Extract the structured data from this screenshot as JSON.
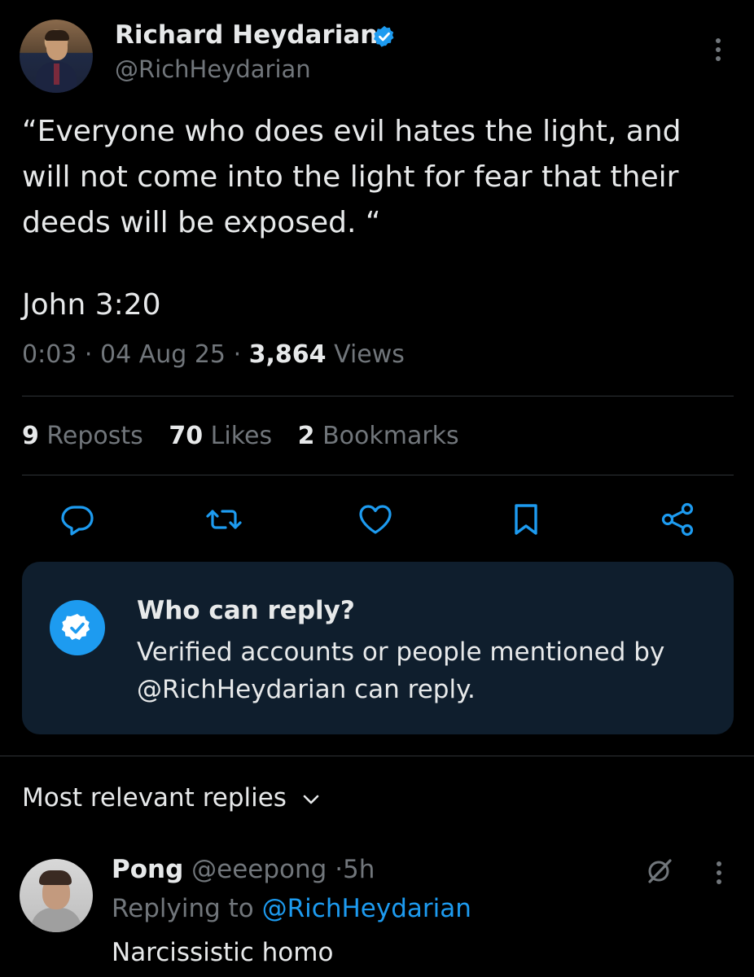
{
  "tweet": {
    "author_name": "Richard Heydarian",
    "author_handle": "@RichHeydarian",
    "text": "“Everyone who does evil hates the light, and will not come into the light for fear that their deeds will be exposed. “",
    "reference": "John 3:20",
    "time": "0:03",
    "date": "04 Aug 25",
    "views_count": "3,864",
    "views_label": "Views",
    "separator": "·"
  },
  "stats": {
    "reposts_count": "9",
    "reposts_label": "Reposts",
    "likes_count": "70",
    "likes_label": "Likes",
    "bookmarks_count": "2",
    "bookmarks_label": "Bookmarks"
  },
  "actions": {
    "icons": [
      "reply-icon",
      "repost-icon",
      "like-icon",
      "bookmark-icon",
      "share-icon"
    ]
  },
  "reply_settings": {
    "title": "Who can reply?",
    "description": "Verified accounts or people mentioned by @RichHeydarian can reply."
  },
  "replies": {
    "heading": "Most relevant replies",
    "items": [
      {
        "name": "Pong",
        "handle": "@eeepong",
        "separator": "·",
        "time": "5h",
        "replying_prefix": "Replying to",
        "replying_to": "@RichHeydarian",
        "text": "Narcissistic homo"
      }
    ]
  },
  "colors": {
    "background": "#000000",
    "text_primary": "#e7e9ea",
    "text_secondary": "#71767b",
    "accent": "#1d9bf0",
    "reply_box": "#0f1e2d",
    "divider": "#2f3336"
  }
}
